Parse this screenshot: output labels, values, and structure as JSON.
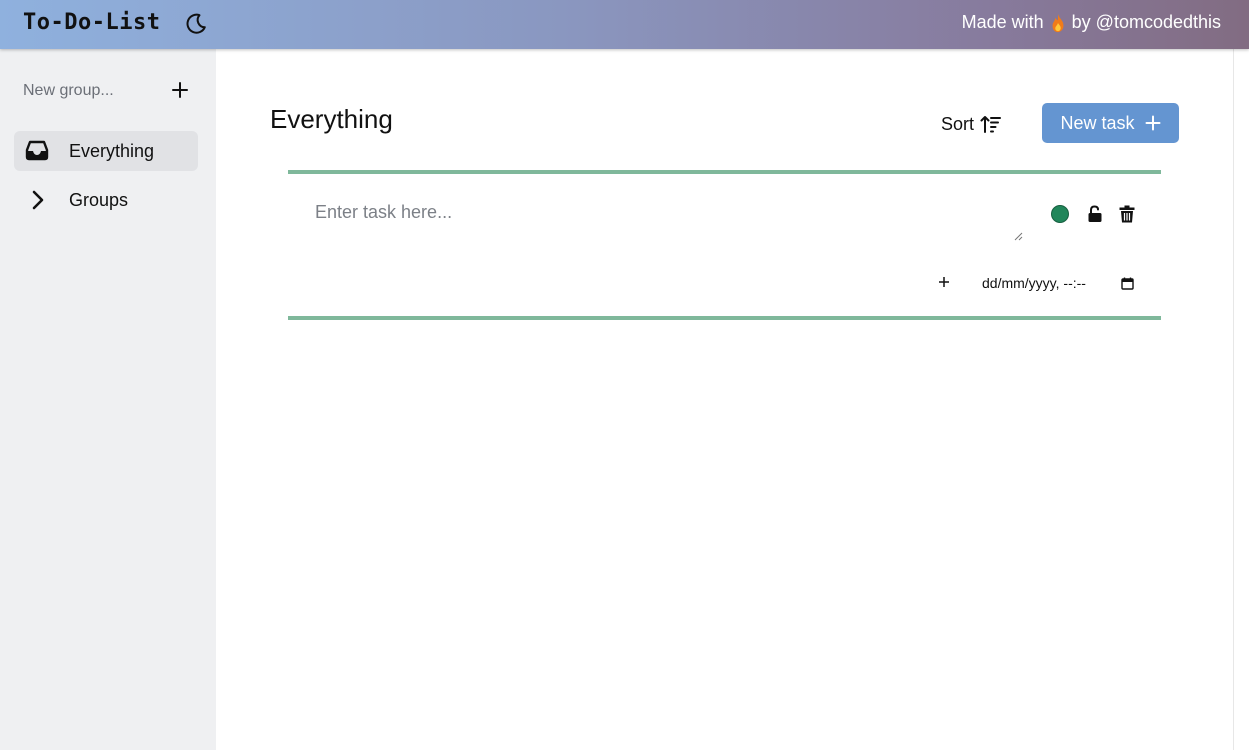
{
  "header": {
    "title": "To-Do-List",
    "theme_icon": "moon-icon",
    "credit_prefix": "Made with",
    "credit_icon": "flame-icon",
    "credit_suffix": "by @tomcodedthis"
  },
  "sidebar": {
    "new_group_placeholder": "New group...",
    "add_icon": "plus-icon",
    "items": [
      {
        "label": "Everything",
        "icon": "inbox-icon",
        "active": true
      },
      {
        "label": "Groups",
        "icon": "chevron-right-icon",
        "active": false
      }
    ]
  },
  "main": {
    "title": "Everything",
    "sort_label": "Sort",
    "sort_icon": "sort-ascending-icon",
    "new_task_label": "New task",
    "new_task_icon": "plus-icon"
  },
  "task": {
    "placeholder": "Enter task here...",
    "value": "",
    "status_color": "#21865a",
    "date_placeholder": "dd/mm/yyyy, --:--",
    "subtask_add_label": "+"
  },
  "colors": {
    "accent": "#6495d1",
    "task_border": "#7fb89b",
    "sidebar_bg": "#eff0f2",
    "active_item_bg": "#e1e2e5"
  }
}
